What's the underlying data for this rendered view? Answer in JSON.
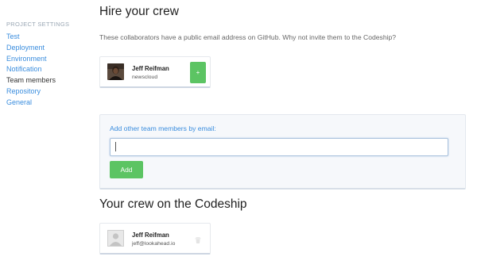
{
  "sidebar": {
    "heading": "PROJECT SETTINGS",
    "items": [
      {
        "label": "Test",
        "active": false
      },
      {
        "label": "Deployment",
        "active": false
      },
      {
        "label": "Environment",
        "active": false
      },
      {
        "label": "Notification",
        "active": false
      },
      {
        "label": "Team members",
        "active": true
      },
      {
        "label": "Repository",
        "active": false
      },
      {
        "label": "General",
        "active": false
      }
    ]
  },
  "hire": {
    "title": "Hire your crew",
    "intro": "These collaborators have a public email address on GitHub. Why not invite them to the Codeship?",
    "suggestion": {
      "name": "Jeff Reifman",
      "subtitle": "newscloud",
      "add_label": "+"
    }
  },
  "invite": {
    "label": "Add other team members by email:",
    "email_value": "",
    "button_label": "Add"
  },
  "crew": {
    "title": "Your crew on the Codeship",
    "member": {
      "name": "Jeff Reifman",
      "email": "jeff@lookahead.io",
      "remove_icon": "trash-icon"
    }
  },
  "colors": {
    "link": "#3a8dde",
    "accent_green": "#5cc463",
    "heading": "#222222",
    "muted": "#9aa7b4"
  }
}
